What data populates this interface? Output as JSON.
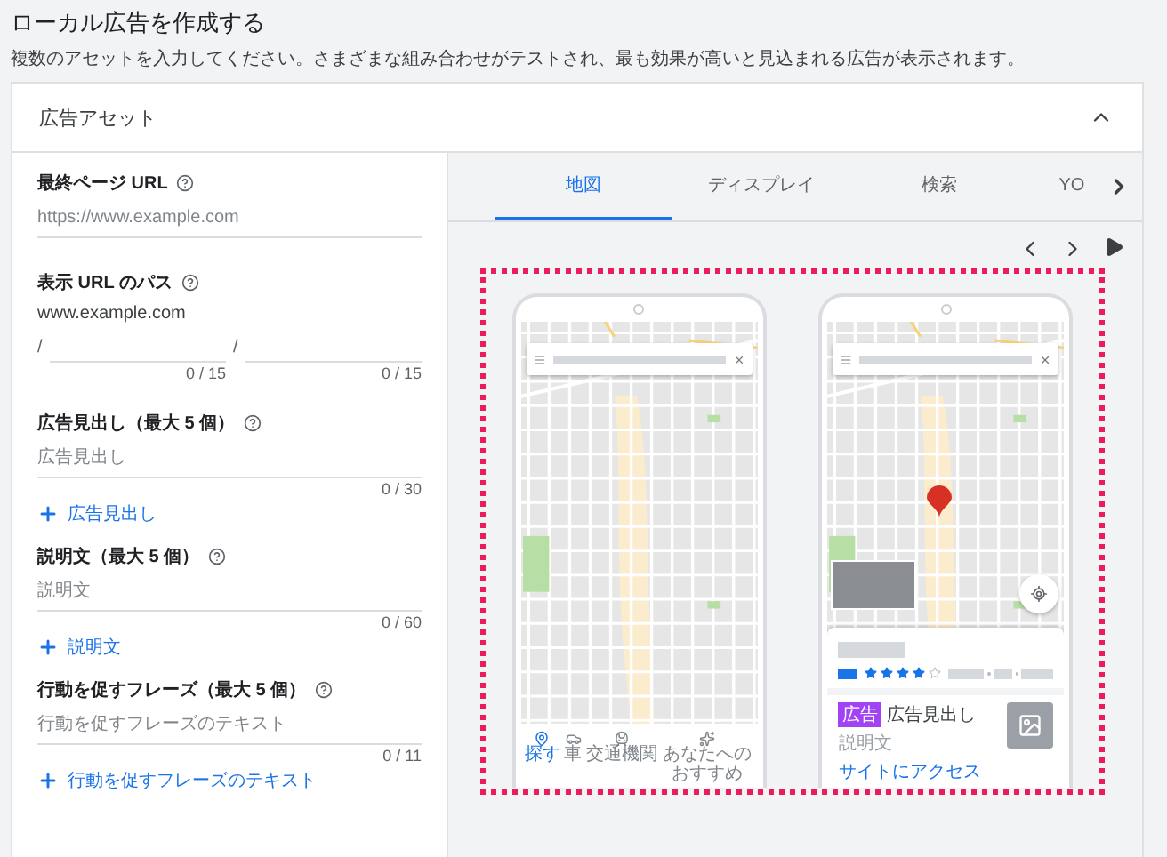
{
  "page": {
    "title": "ローカル広告を作成する",
    "description": "複数のアセットを入力してください。さまざまな組み合わせがテストされ、最も効果が高いと見込まれる広告が表示されます。"
  },
  "card": {
    "title": "広告アセット",
    "expanded": true
  },
  "fields": [
    {
      "kind": "text",
      "label": "最終ページ URL",
      "placeholder": "https://www.example.com"
    },
    {
      "kind": "path",
      "label": "表示 URL のパス",
      "domain": "www.example.com",
      "paths": [
        {
          "separator": "/",
          "counter": "0 / 15"
        },
        {
          "separator": "/",
          "counter": "0 / 15"
        }
      ]
    },
    {
      "kind": "text",
      "label": "広告見出し（最大 5 個）",
      "placeholder": "広告見出し",
      "counter": "0 / 30",
      "add_label": "広告見出し"
    },
    {
      "kind": "text",
      "label": "説明文（最大 5 個）",
      "placeholder": "説明文",
      "counter": "0 / 60",
      "add_label": "説明文"
    },
    {
      "kind": "text",
      "label": "行動を促すフレーズ（最大 5 個）",
      "placeholder": "行動を促すフレーズのテキスト",
      "counter": "0 / 11",
      "add_label": "行動を促すフレーズのテキスト"
    }
  ],
  "preview": {
    "tabs": [
      {
        "label": "地図",
        "selected": true
      },
      {
        "label": "ディスプレイ",
        "selected": false
      },
      {
        "label": "検索",
        "selected": false
      },
      {
        "label": "YO",
        "selected": false
      }
    ],
    "phones": [
      {
        "kind": "map_nav",
        "nav": [
          {
            "label": "探す",
            "selected": true
          },
          {
            "label": "車",
            "selected": false
          },
          {
            "label": "交通機関",
            "selected": false
          },
          {
            "label": "あなたへのおすすめ",
            "selected": false
          }
        ]
      },
      {
        "kind": "listing",
        "stars": 4,
        "ad_badge": "広告",
        "headline": "広告見出し",
        "description": "説明文",
        "link": "サイトにアクセス"
      }
    ]
  }
}
